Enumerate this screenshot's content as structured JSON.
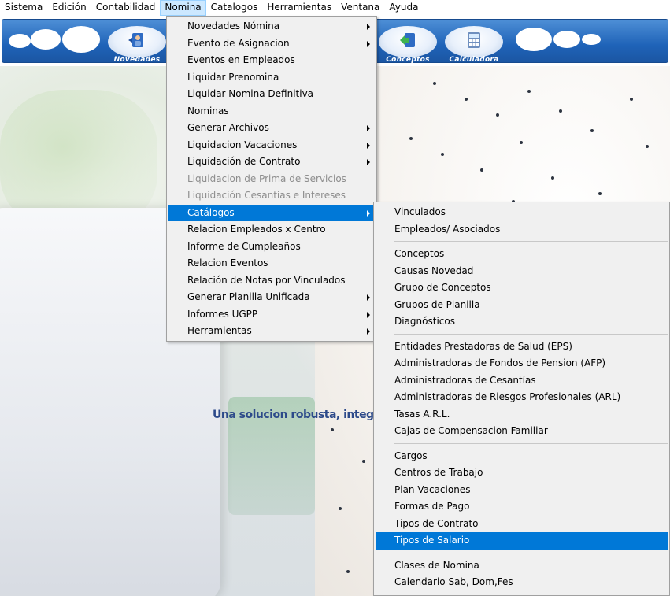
{
  "menubar": {
    "items": [
      "Sistema",
      "Edición",
      "Contabilidad",
      "Nomina",
      "Catalogos",
      "Herramientas",
      "Ventana",
      "Ayuda"
    ],
    "open_index": 3
  },
  "toolbar": {
    "buttons": [
      {
        "label": "Novedades",
        "icon": "user-news-icon"
      },
      {
        "label": "Conceptos",
        "icon": "concept-arrow-icon"
      },
      {
        "label": "Calculadora",
        "icon": "calculator-icon"
      }
    ]
  },
  "background": {
    "slogan": "Una solucion robusta, integral, d"
  },
  "nomina_menu": {
    "items": [
      {
        "label": "Novedades Nómina",
        "submenu": true,
        "disabled": false
      },
      {
        "label": "Evento de Asignacion",
        "submenu": true,
        "disabled": false
      },
      {
        "label": "Eventos en Empleados",
        "submenu": false,
        "disabled": false
      },
      {
        "label": "Liquidar Prenomina",
        "submenu": false,
        "disabled": false
      },
      {
        "label": "Liquidar Nomina Definitiva",
        "submenu": false,
        "disabled": false
      },
      {
        "label": "Nominas",
        "submenu": false,
        "disabled": false
      },
      {
        "label": "Generar Archivos",
        "submenu": true,
        "disabled": false
      },
      {
        "label": "Liquidacion Vacaciones",
        "submenu": true,
        "disabled": false
      },
      {
        "label": "Liquidación de Contrato",
        "submenu": true,
        "disabled": false
      },
      {
        "label": "Liquidacion de Prima de Servicios",
        "submenu": false,
        "disabled": true
      },
      {
        "label": "Liquidación Cesantias e Intereses",
        "submenu": false,
        "disabled": true
      },
      {
        "label": "Catálogos",
        "submenu": true,
        "disabled": false,
        "selected": true
      },
      {
        "label": "Relacion Empleados x Centro",
        "submenu": false,
        "disabled": false
      },
      {
        "label": " Informe de Cumpleaños",
        "submenu": false,
        "disabled": false
      },
      {
        "label": "Relacion Eventos",
        "submenu": false,
        "disabled": false
      },
      {
        "label": "Relación de Notas por Vinculados",
        "submenu": false,
        "disabled": false
      },
      {
        "label": "Generar Planilla Unificada",
        "submenu": true,
        "disabled": false
      },
      {
        "label": "Informes UGPP",
        "submenu": true,
        "disabled": false
      },
      {
        "label": "Herramientas",
        "submenu": true,
        "disabled": false
      }
    ]
  },
  "catalogos_submenu": {
    "groups": [
      [
        "Vinculados",
        "Empleados/ Asociados"
      ],
      [
        "Conceptos",
        "Causas Novedad",
        "Grupo de Conceptos",
        "Grupos de Planilla",
        "Diagnósticos"
      ],
      [
        "Entidades Prestadoras de Salud (EPS)",
        "Administradoras de Fondos de Pension (AFP)",
        "Administradoras de Cesantías",
        "Administradoras de Riesgos Profesionales (ARL)",
        "Tasas A.R.L.",
        "Cajas de Compensacion Familiar"
      ],
      [
        "Cargos",
        "Centros de Trabajo",
        "Plan Vacaciones",
        "Formas de Pago",
        "Tipos de Contrato",
        "Tipos de Salario"
      ],
      [
        "Clases de Nomina",
        "Calendario Sab, Dom,Fes"
      ]
    ],
    "selected_label": "Tipos de Salario"
  },
  "colors": {
    "menu_bg": "#f0f0f0",
    "highlight": "#0078d7",
    "toolbar_blue": "#1f63b8",
    "disabled_text": "#8d8d8d"
  }
}
